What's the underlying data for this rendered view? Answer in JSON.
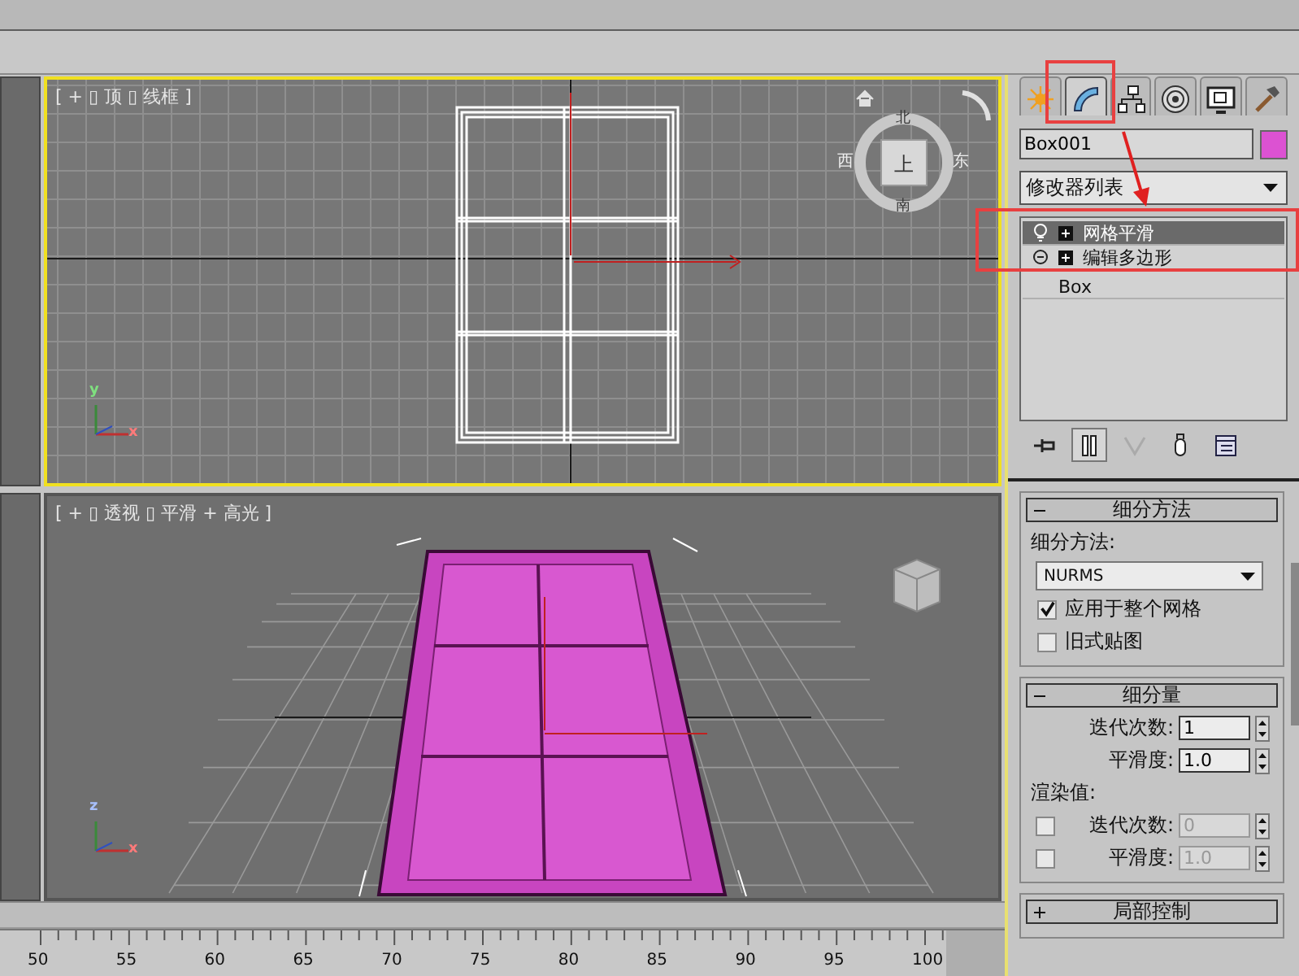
{
  "viewports": [
    {
      "kind": "top",
      "label": "[ + ▯ 顶 ▯ 线框 ]",
      "active": true,
      "axis_labels": [
        "y",
        "x"
      ],
      "viewcube": {
        "north": "北",
        "west": "西",
        "face": "上",
        "east": "东",
        "south": "南"
      }
    },
    {
      "kind": "perspective",
      "label": "[ + ▯ 透视 ▯ 平滑 + 高光 ]",
      "active": false,
      "axis_labels": [
        "z",
        "x"
      ]
    }
  ],
  "command_panel": {
    "tabs": [
      {
        "kind": "create",
        "selected": false
      },
      {
        "kind": "modify",
        "selected": true
      },
      {
        "kind": "hierarchy",
        "selected": false
      },
      {
        "kind": "motion",
        "selected": false
      },
      {
        "kind": "display",
        "selected": false
      },
      {
        "kind": "utilities",
        "selected": false
      }
    ],
    "object_name": "Box001",
    "modifier_list": "修改器列表",
    "stack": [
      {
        "kind": "modifier",
        "label": "网格平滑",
        "selected": true
      },
      {
        "kind": "modifier",
        "label": "编辑多边形",
        "selected": false
      },
      {
        "kind": "base",
        "label": "Box",
        "selected": false
      }
    ],
    "rollouts": [
      {
        "kind": "method",
        "title": "细分方法",
        "expanded": true,
        "method_label": "细分方法:",
        "method": "NURMS",
        "options": [
          {
            "label": "应用于整个网格",
            "checked": true
          },
          {
            "label": "旧式贴图",
            "checked": false
          }
        ]
      },
      {
        "kind": "amount",
        "title": "细分量",
        "expanded": true,
        "fields": [
          {
            "label": "迭代次数:",
            "value": "1"
          },
          {
            "label": "平滑度:",
            "value": "1.0"
          }
        ],
        "render_label": "渲染值:",
        "render_fields": [
          {
            "label": "迭代次数:",
            "value": "0",
            "checked": false
          },
          {
            "label": "平滑度:",
            "value": "1.0",
            "checked": false
          }
        ]
      },
      {
        "kind": "local",
        "title": "局部控制",
        "expanded": false
      }
    ]
  },
  "ruler": {
    "ticks": [
      "50",
      "55",
      "60",
      "65",
      "70",
      "75",
      "80",
      "85",
      "90",
      "95",
      "100"
    ]
  }
}
